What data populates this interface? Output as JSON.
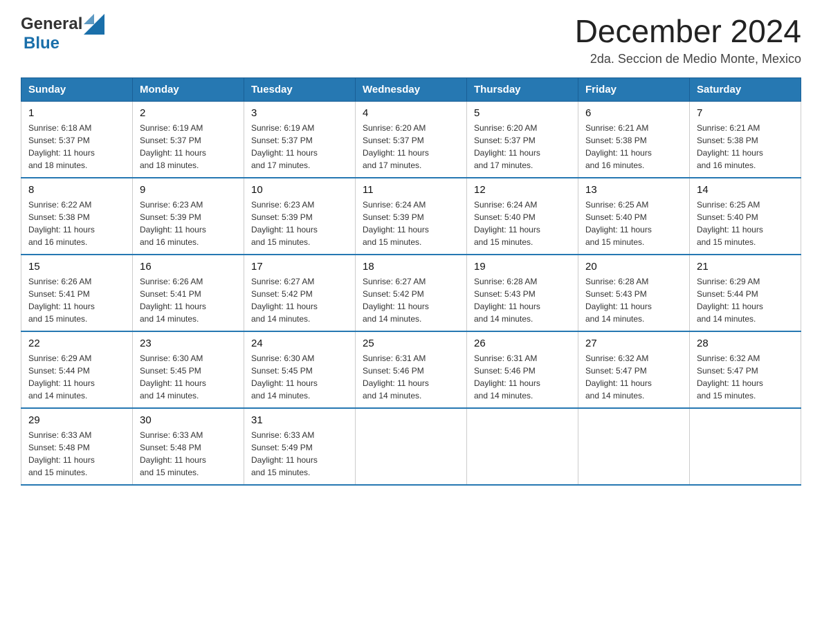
{
  "header": {
    "logo_general": "General",
    "logo_blue": "Blue",
    "title": "December 2024",
    "subtitle": "2da. Seccion de Medio Monte, Mexico"
  },
  "days_of_week": [
    "Sunday",
    "Monday",
    "Tuesday",
    "Wednesday",
    "Thursday",
    "Friday",
    "Saturday"
  ],
  "weeks": [
    [
      {
        "day": "1",
        "sunrise": "6:18 AM",
        "sunset": "5:37 PM",
        "daylight": "11 hours and 18 minutes."
      },
      {
        "day": "2",
        "sunrise": "6:19 AM",
        "sunset": "5:37 PM",
        "daylight": "11 hours and 18 minutes."
      },
      {
        "day": "3",
        "sunrise": "6:19 AM",
        "sunset": "5:37 PM",
        "daylight": "11 hours and 17 minutes."
      },
      {
        "day": "4",
        "sunrise": "6:20 AM",
        "sunset": "5:37 PM",
        "daylight": "11 hours and 17 minutes."
      },
      {
        "day": "5",
        "sunrise": "6:20 AM",
        "sunset": "5:37 PM",
        "daylight": "11 hours and 17 minutes."
      },
      {
        "day": "6",
        "sunrise": "6:21 AM",
        "sunset": "5:38 PM",
        "daylight": "11 hours and 16 minutes."
      },
      {
        "day": "7",
        "sunrise": "6:21 AM",
        "sunset": "5:38 PM",
        "daylight": "11 hours and 16 minutes."
      }
    ],
    [
      {
        "day": "8",
        "sunrise": "6:22 AM",
        "sunset": "5:38 PM",
        "daylight": "11 hours and 16 minutes."
      },
      {
        "day": "9",
        "sunrise": "6:23 AM",
        "sunset": "5:39 PM",
        "daylight": "11 hours and 16 minutes."
      },
      {
        "day": "10",
        "sunrise": "6:23 AM",
        "sunset": "5:39 PM",
        "daylight": "11 hours and 15 minutes."
      },
      {
        "day": "11",
        "sunrise": "6:24 AM",
        "sunset": "5:39 PM",
        "daylight": "11 hours and 15 minutes."
      },
      {
        "day": "12",
        "sunrise": "6:24 AM",
        "sunset": "5:40 PM",
        "daylight": "11 hours and 15 minutes."
      },
      {
        "day": "13",
        "sunrise": "6:25 AM",
        "sunset": "5:40 PM",
        "daylight": "11 hours and 15 minutes."
      },
      {
        "day": "14",
        "sunrise": "6:25 AM",
        "sunset": "5:40 PM",
        "daylight": "11 hours and 15 minutes."
      }
    ],
    [
      {
        "day": "15",
        "sunrise": "6:26 AM",
        "sunset": "5:41 PM",
        "daylight": "11 hours and 15 minutes."
      },
      {
        "day": "16",
        "sunrise": "6:26 AM",
        "sunset": "5:41 PM",
        "daylight": "11 hours and 14 minutes."
      },
      {
        "day": "17",
        "sunrise": "6:27 AM",
        "sunset": "5:42 PM",
        "daylight": "11 hours and 14 minutes."
      },
      {
        "day": "18",
        "sunrise": "6:27 AM",
        "sunset": "5:42 PM",
        "daylight": "11 hours and 14 minutes."
      },
      {
        "day": "19",
        "sunrise": "6:28 AM",
        "sunset": "5:43 PM",
        "daylight": "11 hours and 14 minutes."
      },
      {
        "day": "20",
        "sunrise": "6:28 AM",
        "sunset": "5:43 PM",
        "daylight": "11 hours and 14 minutes."
      },
      {
        "day": "21",
        "sunrise": "6:29 AM",
        "sunset": "5:44 PM",
        "daylight": "11 hours and 14 minutes."
      }
    ],
    [
      {
        "day": "22",
        "sunrise": "6:29 AM",
        "sunset": "5:44 PM",
        "daylight": "11 hours and 14 minutes."
      },
      {
        "day": "23",
        "sunrise": "6:30 AM",
        "sunset": "5:45 PM",
        "daylight": "11 hours and 14 minutes."
      },
      {
        "day": "24",
        "sunrise": "6:30 AM",
        "sunset": "5:45 PM",
        "daylight": "11 hours and 14 minutes."
      },
      {
        "day": "25",
        "sunrise": "6:31 AM",
        "sunset": "5:46 PM",
        "daylight": "11 hours and 14 minutes."
      },
      {
        "day": "26",
        "sunrise": "6:31 AM",
        "sunset": "5:46 PM",
        "daylight": "11 hours and 14 minutes."
      },
      {
        "day": "27",
        "sunrise": "6:32 AM",
        "sunset": "5:47 PM",
        "daylight": "11 hours and 14 minutes."
      },
      {
        "day": "28",
        "sunrise": "6:32 AM",
        "sunset": "5:47 PM",
        "daylight": "11 hours and 15 minutes."
      }
    ],
    [
      {
        "day": "29",
        "sunrise": "6:33 AM",
        "sunset": "5:48 PM",
        "daylight": "11 hours and 15 minutes."
      },
      {
        "day": "30",
        "sunrise": "6:33 AM",
        "sunset": "5:48 PM",
        "daylight": "11 hours and 15 minutes."
      },
      {
        "day": "31",
        "sunrise": "6:33 AM",
        "sunset": "5:49 PM",
        "daylight": "11 hours and 15 minutes."
      },
      null,
      null,
      null,
      null
    ]
  ],
  "labels": {
    "sunrise": "Sunrise:",
    "sunset": "Sunset:",
    "daylight": "Daylight:"
  }
}
